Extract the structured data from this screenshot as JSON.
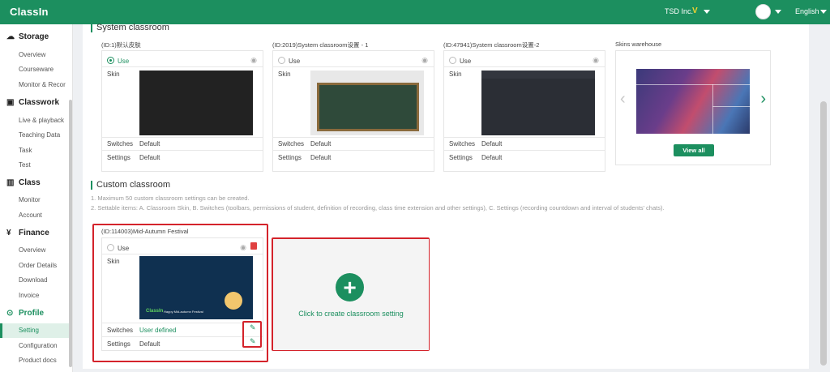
{
  "topbar": {
    "logo": "ClassIn",
    "org_name": "TSD Inc.",
    "org_mark": "V",
    "language": "English"
  },
  "sidebar": {
    "sections": [
      {
        "title": "Storage",
        "icon": "cloud-icon",
        "items": [
          "Overview",
          "Courseware",
          "Monitor & Recor"
        ]
      },
      {
        "title": "Classwork",
        "icon": "classwork-icon",
        "items": [
          "Live & playback",
          "Teaching Data",
          "Task",
          "Test"
        ]
      },
      {
        "title": "Class",
        "icon": "class-icon",
        "items": [
          "Monitor",
          "Account"
        ]
      },
      {
        "title": "Finance",
        "icon": "finance-icon",
        "items": [
          "Overview",
          "Order Details",
          "Download",
          "Invoice"
        ]
      },
      {
        "title": "Profile",
        "icon": "profile-icon",
        "items": [
          "Setting",
          "Configuration",
          "Product docs"
        ]
      }
    ],
    "active_item": "Setting"
  },
  "system": {
    "heading": "System classroom",
    "cards": [
      {
        "title": "(ID:1)默认皮肤",
        "use": "Use",
        "skin_label": "Skin",
        "switches_label": "Switches",
        "switches_value": "Default",
        "settings_label": "Settings",
        "settings_value": "Default"
      },
      {
        "title": "(ID:2019)System classroom设置 - 1",
        "use": "Use",
        "skin_label": "Skin",
        "switches_label": "Switches",
        "switches_value": "Default",
        "settings_label": "Settings",
        "settings_value": "Default"
      },
      {
        "title": "(ID:47941)System classroom设置-2",
        "use": "Use",
        "skin_label": "Skin",
        "switches_label": "Switches",
        "switches_value": "Default",
        "settings_label": "Settings",
        "settings_value": "Default"
      }
    ],
    "warehouse": {
      "title": "Skins warehouse",
      "button": "View all"
    }
  },
  "custom": {
    "heading": "Custom classroom",
    "note1": "1. Maximum 50 custom classroom settings can be created.",
    "note2": "2. Settable items: A. Classroom Skin, B. Switches (toolbars, permissions of student, definition of recording, class time extension and other settings), C. Settings (recording countdown and interval of students’  chats).",
    "card": {
      "title": "(ID:114003)Mid-Autumn Festival",
      "use": "Use",
      "skin_label": "Skin",
      "switches_label": "Switches",
      "switches_value": "User defined",
      "settings_label": "Settings",
      "settings_value": "Default",
      "skin_brand": "ClassIn",
      "skin_caption": "Happy Mid-autumn Festival"
    },
    "create_label": "Click to create classroom setting"
  },
  "colors": {
    "brand": "#1c8f5f",
    "highlight": "#d4232b"
  }
}
